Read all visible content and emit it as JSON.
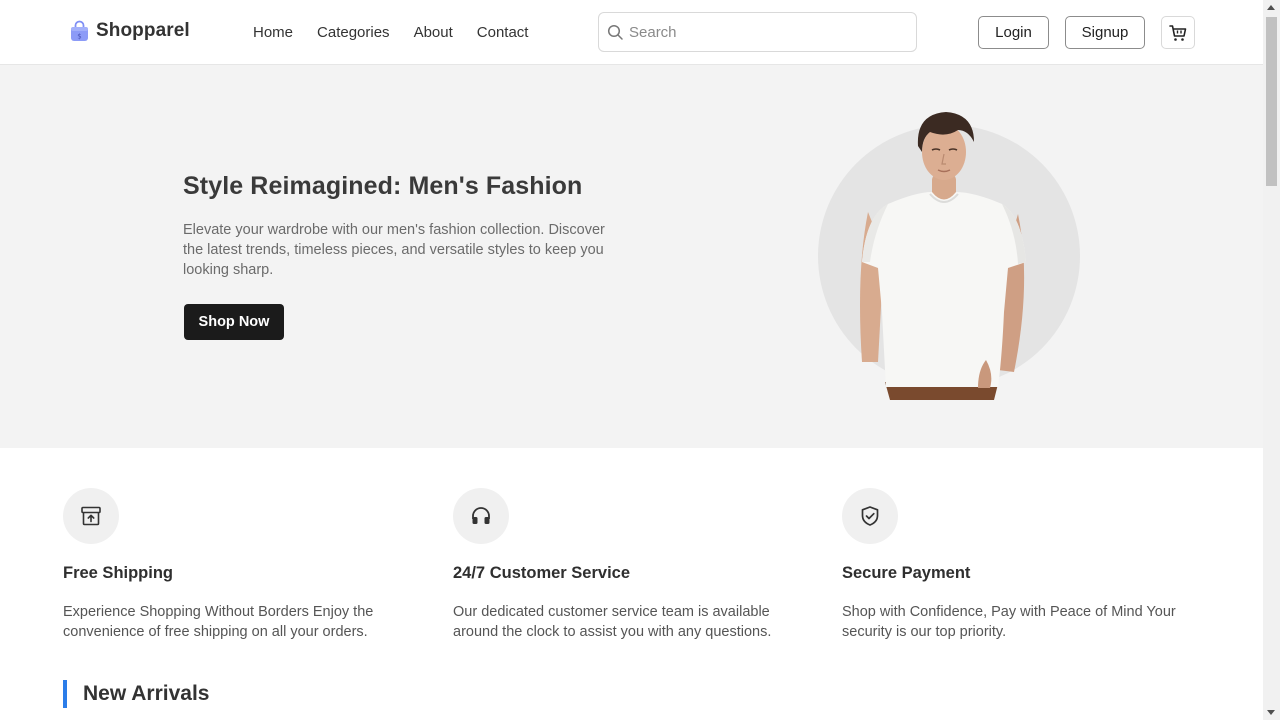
{
  "header": {
    "brand": "Shopparel",
    "nav": [
      "Home",
      "Categories",
      "About",
      "Contact"
    ],
    "search_placeholder": "Search",
    "login_label": "Login",
    "signup_label": "Signup"
  },
  "hero": {
    "title": "Style Reimagined: Men's Fashion",
    "description": "Elevate your wardrobe with our men's fashion collection. Discover the latest trends, timeless pieces, and versatile styles to keep you looking sharp.",
    "cta_label": "Shop Now"
  },
  "features": [
    {
      "icon": "archive-box-icon",
      "title": "Free Shipping",
      "description": "Experience Shopping Without Borders Enjoy the convenience of free shipping on all your orders."
    },
    {
      "icon": "headphones-icon",
      "title": "24/7 Customer Service",
      "description": "Our dedicated customer service team is available around the clock to assist you with any questions."
    },
    {
      "icon": "shield-check-icon",
      "title": "Secure Payment",
      "description": "Shop with Confidence, Pay with Peace of Mind Your security is our top priority."
    }
  ],
  "new_arrivals": {
    "title": "New Arrivals"
  },
  "colors": {
    "accent_bar": "#2b7de9",
    "primary_button": "#1b1b1b",
    "hero_background": "#f3f3f3"
  }
}
